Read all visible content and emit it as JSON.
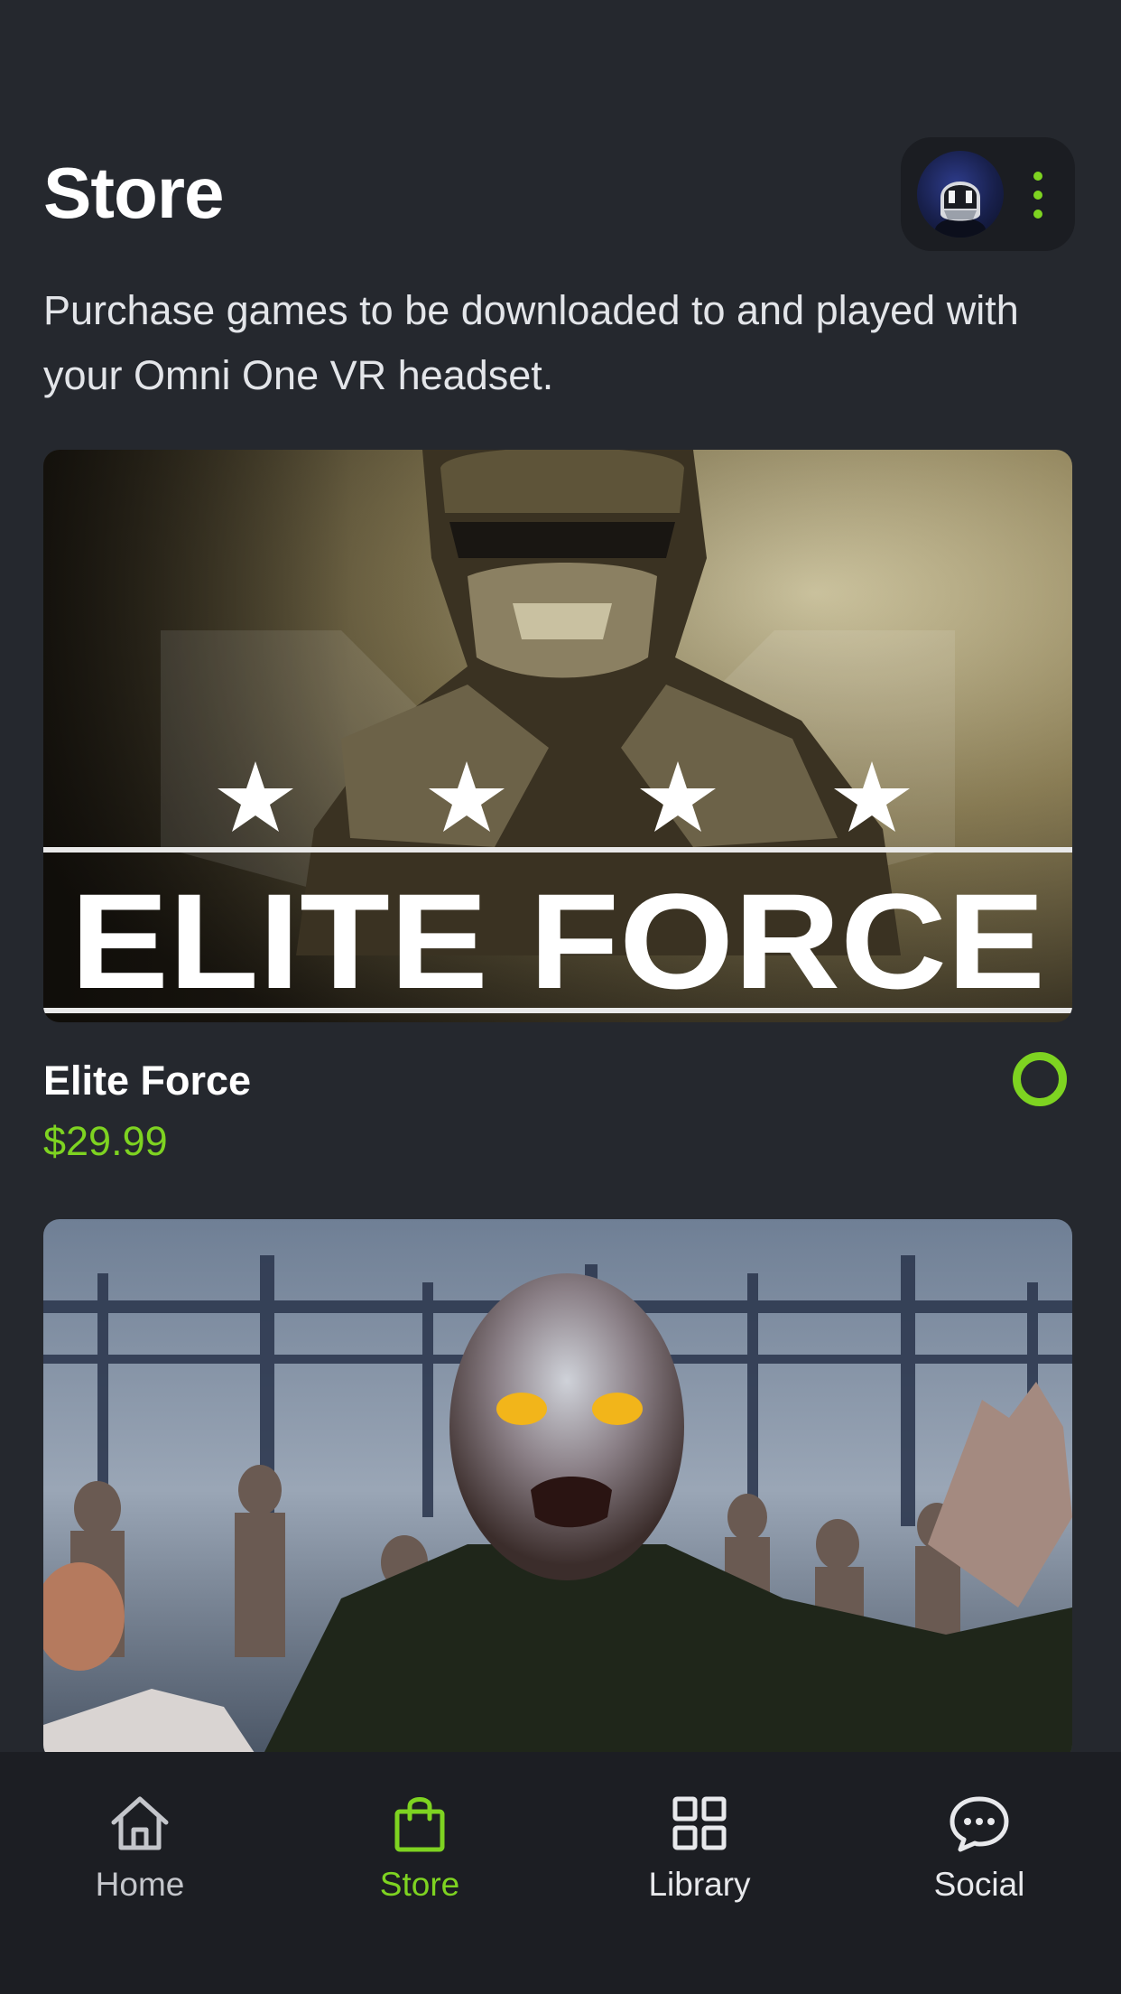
{
  "header": {
    "title": "Store",
    "subtitle": "Purchase games to be downloaded to and played with your Omni One VR headset."
  },
  "profile": {
    "avatar_icon": "vr-helmet-avatar",
    "menu_icon": "kebab-menu-icon"
  },
  "games": [
    {
      "banner_text": "ELITE FORCE",
      "title": "Elite Force",
      "price": "$29.99",
      "selection_icon": "radio-ring-icon"
    },
    {
      "banner_text": "",
      "title": "",
      "price": ""
    }
  ],
  "bottom_nav": {
    "items": [
      {
        "label": "Home",
        "icon": "home-icon"
      },
      {
        "label": "Store",
        "icon": "shopping-bag-icon",
        "active": true
      },
      {
        "label": "Library",
        "icon": "grid-icon"
      },
      {
        "label": "Social",
        "icon": "chat-bubble-icon"
      }
    ]
  },
  "colors": {
    "background": "#25282e",
    "accent": "#7ed321",
    "nav_background": "#1c1e23"
  }
}
